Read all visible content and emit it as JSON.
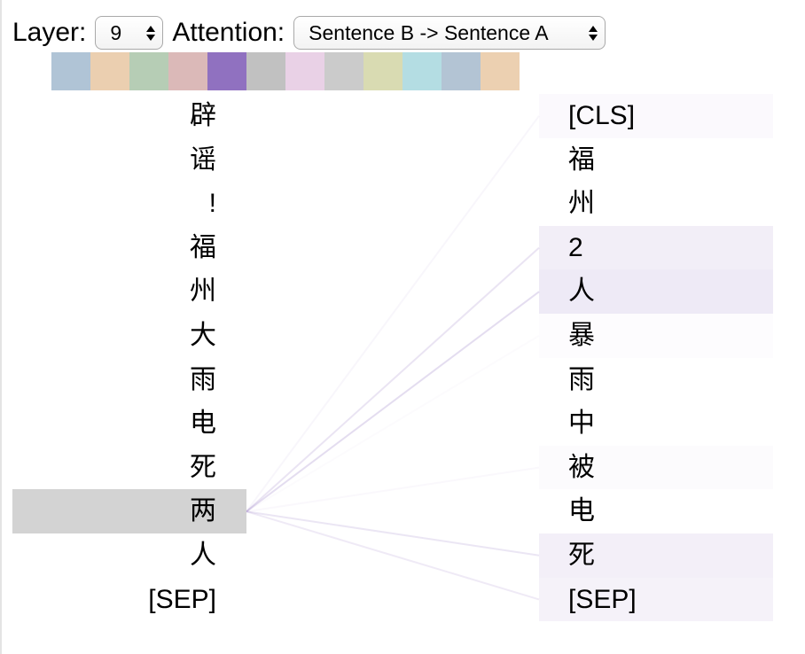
{
  "controls": {
    "layer_label": "Layer:",
    "layer_value": "9",
    "attention_label": "Attention:",
    "attention_value": "Sentence B -> Sentence A"
  },
  "head_colors": [
    "#b0c4d6",
    "#ebcfb0",
    "#b6cdb5",
    "#dbb9b8",
    "#9071c0",
    "#c1c1c1",
    "#e9d1e6",
    "#cbcbcb",
    "#d9dbb2",
    "#b4dde3",
    "#b3c4d4",
    "#ecd0b1"
  ],
  "selected_head_color": "#9071c0",
  "left_tokens": [
    "辟",
    "谣",
    "!",
    "福",
    "州",
    "大",
    "雨",
    "电",
    "死",
    "两",
    "人",
    "[SEP]"
  ],
  "right_tokens": [
    "[CLS]",
    "福",
    "州",
    "2",
    "人",
    "暴",
    "雨",
    "中",
    "被",
    "电",
    "死",
    "[SEP]"
  ],
  "selected_left_index": 9,
  "attention_weights": [
    0.04,
    0.0,
    0.0,
    0.12,
    0.15,
    0.02,
    0.0,
    0.0,
    0.03,
    0.0,
    0.11,
    0.09
  ]
}
